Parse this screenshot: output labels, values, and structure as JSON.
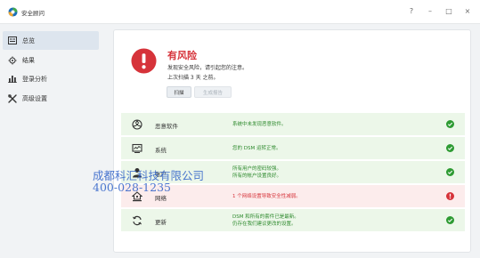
{
  "app": {
    "title": "安全顾问"
  },
  "window_controls": {
    "help": "?",
    "minimize": "–",
    "maximize": "□",
    "close": "×"
  },
  "sidebar": {
    "items": [
      {
        "label": "总览",
        "icon": "overview-icon",
        "active": true
      },
      {
        "label": "结果",
        "icon": "results-icon",
        "active": false
      },
      {
        "label": "登录分析",
        "icon": "login-analysis-icon",
        "active": false
      },
      {
        "label": "高级设置",
        "icon": "advanced-settings-icon",
        "active": false
      }
    ]
  },
  "status": {
    "title": "有风险",
    "description": "发现安全风险，请引起您的注意。",
    "last_scan": "上次扫描 3 天 之前。",
    "scan_button": "扫描",
    "report_button": "生成报告"
  },
  "checks": [
    {
      "name": "恶意软件",
      "icon": "malware-icon",
      "message": [
        "系统中未发现恶意软件。"
      ],
      "state": "ok"
    },
    {
      "name": "系统",
      "icon": "system-icon",
      "message": [
        "您的 DSM 运转正常。"
      ],
      "state": "ok"
    },
    {
      "name": "账户",
      "icon": "account-icon",
      "message": [
        "所有用户的密码较强。",
        "所有的帐户设置良好。"
      ],
      "state": "ok"
    },
    {
      "name": "网络",
      "icon": "network-icon",
      "message": [
        "1 个网络设置导致安全性减弱。"
      ],
      "state": "warning"
    },
    {
      "name": "更新",
      "icon": "update-icon",
      "message": [
        "DSM 和所有的套件已是最新。",
        "仍存在我们建议更改的设置。"
      ],
      "state": "ok"
    }
  ],
  "watermark": {
    "line1": "成都科汇科技有限公司",
    "line2": "400-028-1235"
  },
  "colors": {
    "risk_red": "#d6333a",
    "ok_green": "#2e9b33",
    "ok_bg": "#ecf7e9",
    "bad_bg": "#fcecec",
    "active_nav": "#dde5ee"
  }
}
